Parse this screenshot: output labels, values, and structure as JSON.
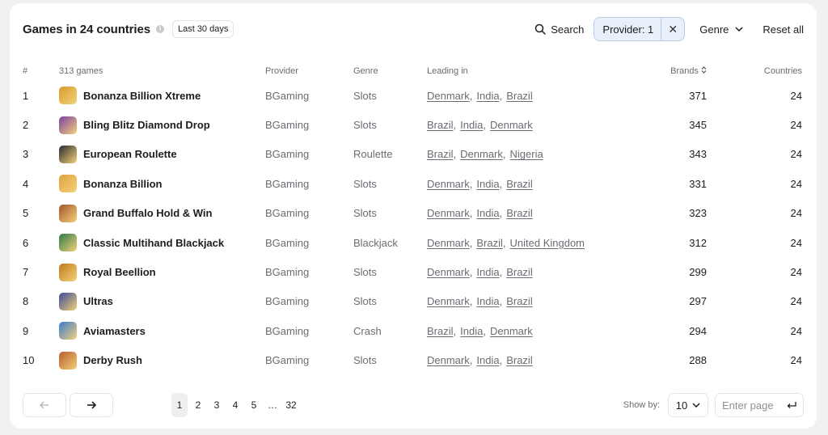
{
  "header": {
    "title": "Games in 24 countries",
    "info_icon": "info-icon",
    "period": "Last 30 days",
    "search_label": "Search",
    "provider_chip": "Provider: 1",
    "genre_label": "Genre",
    "reset_label": "Reset all"
  },
  "table": {
    "columns": {
      "rank": "#",
      "games": "313 games",
      "provider": "Provider",
      "genre": "Genre",
      "leading": "Leading in",
      "brands": "Brands",
      "countries": "Countries"
    },
    "rows": [
      {
        "rank": "1",
        "name": "Bonanza Billion Xtreme",
        "provider": "BGaming",
        "genre": "Slots",
        "leading": [
          "Denmark",
          "India",
          "Brazil"
        ],
        "brands": "371",
        "countries": "24",
        "color": "#d79b2b"
      },
      {
        "rank": "2",
        "name": "Bling Blitz Diamond Drop",
        "provider": "BGaming",
        "genre": "Slots",
        "leading": [
          "Brazil",
          "India",
          "Denmark"
        ],
        "brands": "345",
        "countries": "24",
        "color": "#7b3fa0"
      },
      {
        "rank": "3",
        "name": "European Roulette",
        "provider": "BGaming",
        "genre": "Roulette",
        "leading": [
          "Brazil",
          "Denmark",
          "Nigeria"
        ],
        "brands": "343",
        "countries": "24",
        "color": "#2a2a30"
      },
      {
        "rank": "4",
        "name": "Bonanza Billion",
        "provider": "BGaming",
        "genre": "Slots",
        "leading": [
          "Denmark",
          "India",
          "Brazil"
        ],
        "brands": "331",
        "countries": "24",
        "color": "#e0a23c"
      },
      {
        "rank": "5",
        "name": "Grand Buffalo Hold & Win",
        "provider": "BGaming",
        "genre": "Slots",
        "leading": [
          "Denmark",
          "India",
          "Brazil"
        ],
        "brands": "323",
        "countries": "24",
        "color": "#a5532a"
      },
      {
        "rank": "6",
        "name": "Classic Multihand Blackjack",
        "provider": "BGaming",
        "genre": "Blackjack",
        "leading": [
          "Denmark",
          "Brazil",
          "United Kingdom"
        ],
        "brands": "312",
        "countries": "24",
        "color": "#2f7a4a"
      },
      {
        "rank": "7",
        "name": "Royal Beellion",
        "provider": "BGaming",
        "genre": "Slots",
        "leading": [
          "Denmark",
          "India",
          "Brazil"
        ],
        "brands": "299",
        "countries": "24",
        "color": "#c07a1a"
      },
      {
        "rank": "8",
        "name": "Ultras",
        "provider": "BGaming",
        "genre": "Slots",
        "leading": [
          "Denmark",
          "India",
          "Brazil"
        ],
        "brands": "297",
        "countries": "24",
        "color": "#3a4a9a"
      },
      {
        "rank": "9",
        "name": "Aviamasters",
        "provider": "BGaming",
        "genre": "Crash",
        "leading": [
          "Brazil",
          "India",
          "Denmark"
        ],
        "brands": "294",
        "countries": "24",
        "color": "#3a7bd0"
      },
      {
        "rank": "10",
        "name": "Derby Rush",
        "provider": "BGaming",
        "genre": "Slots",
        "leading": [
          "Denmark",
          "India",
          "Brazil"
        ],
        "brands": "288",
        "countries": "24",
        "color": "#b85a2c"
      }
    ]
  },
  "pagination": {
    "pages": [
      "1",
      "2",
      "3",
      "4",
      "5",
      "…",
      "32"
    ],
    "current": "1",
    "show_by_label": "Show by:",
    "show_by_value": "10",
    "enter_page_placeholder": "Enter page"
  }
}
